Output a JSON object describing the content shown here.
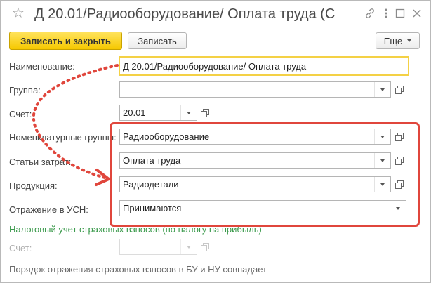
{
  "window": {
    "title": "Д 20.01/Радиооборудование/ Оплата труда (С...",
    "icons": {
      "favorite": "star-icon",
      "link": "link-icon",
      "menu": "more-vertical-icon",
      "maximize": "maximize-icon",
      "close": "close-icon"
    }
  },
  "toolbar": {
    "save_close_label": "Записать и закрыть",
    "save_label": "Записать",
    "more_label": "Еще"
  },
  "form": {
    "name": {
      "label": "Наименование:",
      "value": "Д 20.01/Радиооборудование/ Оплата труда"
    },
    "group": {
      "label": "Группа:",
      "value": ""
    },
    "account": {
      "label": "Счет:",
      "value": "20.01"
    },
    "nomenclature_groups": {
      "label": "Номенклатурные группы:",
      "value": "Радиооборудование"
    },
    "cost_items": {
      "label": "Статьи затрат:",
      "value": "Оплата труда"
    },
    "products": {
      "label": "Продукция:",
      "value": "Радиодетали"
    },
    "usn": {
      "label": "Отражение в УСН:",
      "value": "Принимаются"
    }
  },
  "insurance_section": {
    "title": "Налоговый учет страховых взносов (по налогу на прибыль)",
    "account_label": "Счет:",
    "account_value": "",
    "note": "Порядок отражения страховых взносов в БУ и НУ совпадает"
  },
  "colors": {
    "accent_yellow": "#f6c800",
    "annotation_red": "#e0463c",
    "section_green": "#3b9a4c"
  }
}
